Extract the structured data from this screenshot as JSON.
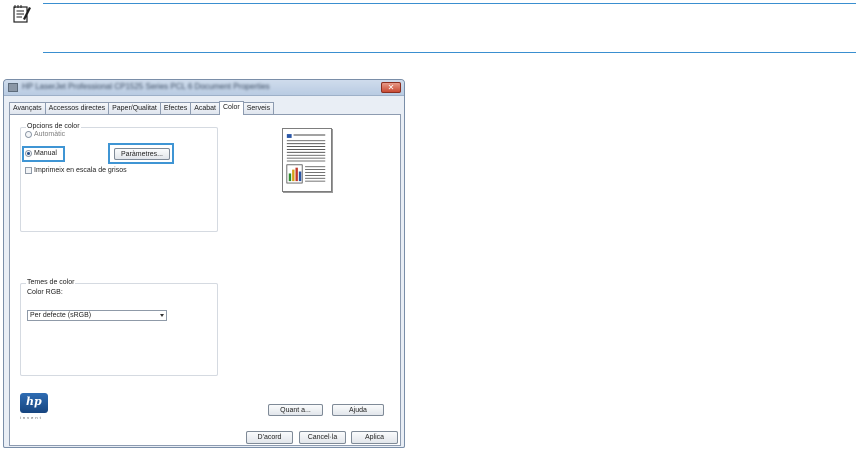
{
  "window": {
    "title": "HP LaserJet Professional CP1525 Series PCL 6 Document Properties",
    "close_glyph": "✕"
  },
  "tabs": [
    {
      "label": "Avançats"
    },
    {
      "label": "Accessos directes"
    },
    {
      "label": "Paper/Qualitat"
    },
    {
      "label": "Efectes"
    },
    {
      "label": "Acabat"
    },
    {
      "label": "Color",
      "active": true
    },
    {
      "label": "Serveis"
    }
  ],
  "color_options": {
    "legend": "Opcions de color",
    "automatic_label": "Automàtic",
    "manual_label": "Manual",
    "settings_button": "Paràmetres...",
    "grayscale_label": "Imprimeix en escala de grisos",
    "selected": "manual",
    "grayscale_checked": false
  },
  "color_themes": {
    "legend": "Temes de color",
    "rgb_label": "Color RGB:",
    "rgb_value": "Per defecte (sRGB)"
  },
  "branding": {
    "logo_text": "hp",
    "tagline": "invent"
  },
  "buttons": {
    "about": "Quant a...",
    "help": "Ajuda",
    "ok": "D'acord",
    "cancel": "Cancel·la",
    "apply": "Aplica"
  },
  "colors": {
    "highlight": "#3f95d4",
    "rule": "#3a8fd0"
  }
}
